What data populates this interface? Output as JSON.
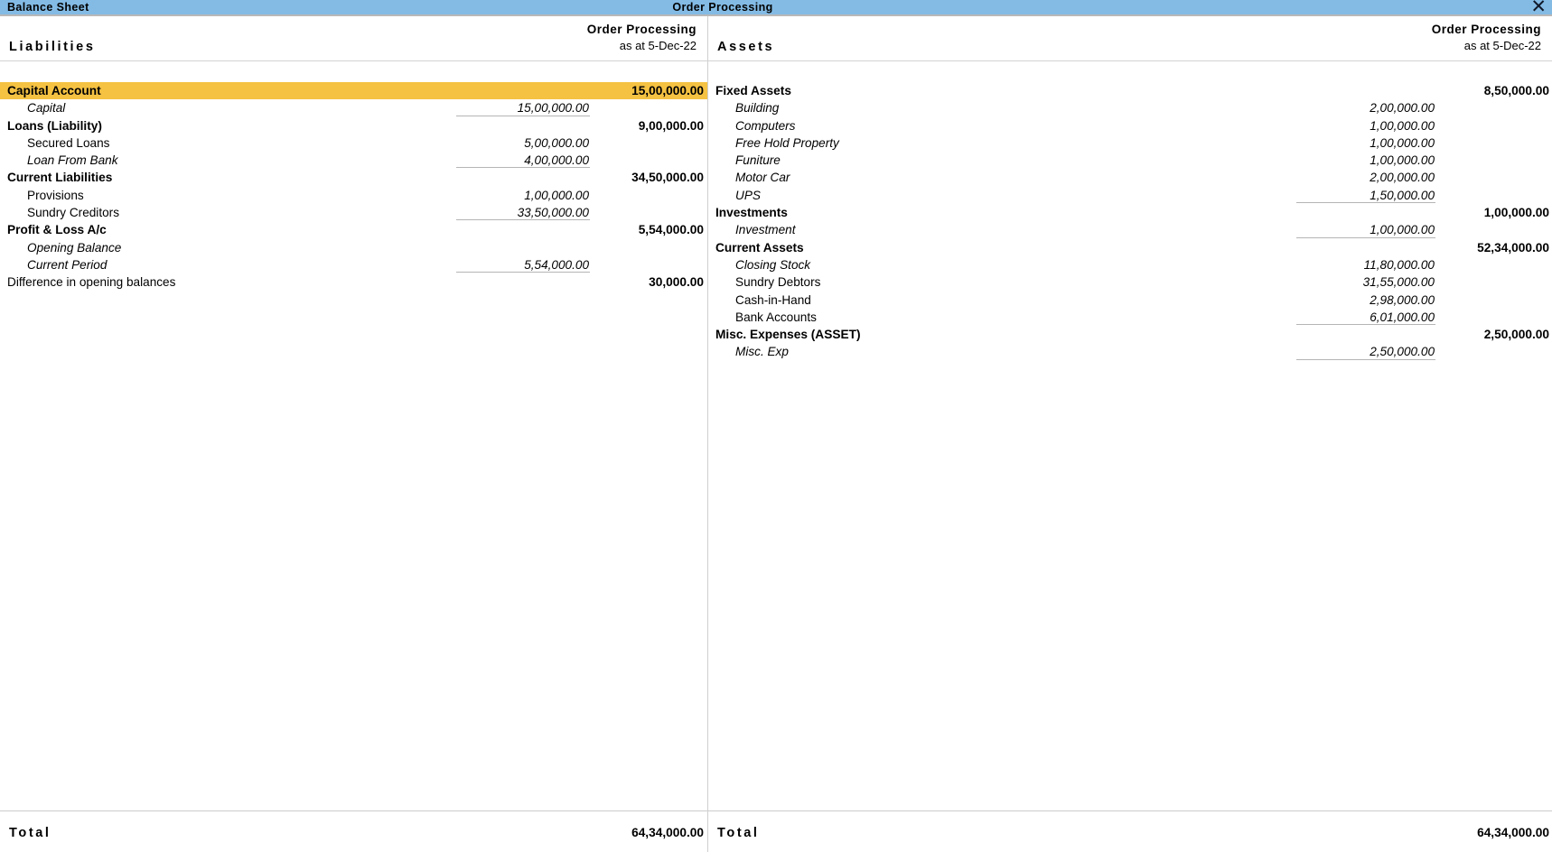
{
  "titlebar": {
    "report_title": "Balance Sheet",
    "company_title": "Order  Processing",
    "close_label": "✕"
  },
  "left": {
    "side_title": "Liabilities",
    "company": "Order  Processing",
    "as_at": "as at 5-Dec-22",
    "total_label": "Total",
    "total_amount": "64,34,000.00",
    "rows": [
      {
        "label": "Capital Account",
        "kind": "group",
        "italic": false,
        "highlight": true,
        "total": "15,00,000.00"
      },
      {
        "label": "Capital",
        "kind": "item",
        "italic": true,
        "ruled": true,
        "sub": "15,00,000.00"
      },
      {
        "label": "Loans (Liability)",
        "kind": "group",
        "italic": false,
        "total": "9,00,000.00"
      },
      {
        "label": "Secured Loans",
        "kind": "item",
        "italic": false,
        "sub": "5,00,000.00"
      },
      {
        "label": "Loan From Bank",
        "kind": "item",
        "italic": true,
        "ruled": true,
        "sub": "4,00,000.00"
      },
      {
        "label": "Current Liabilities",
        "kind": "group",
        "italic": false,
        "total": "34,50,000.00"
      },
      {
        "label": "Provisions",
        "kind": "item",
        "italic": false,
        "sub": "1,00,000.00"
      },
      {
        "label": "Sundry Creditors",
        "kind": "item",
        "italic": false,
        "ruled": true,
        "sub": "33,50,000.00"
      },
      {
        "label": "Profit & Loss A/c",
        "kind": "group",
        "italic": false,
        "total": "5,54,000.00"
      },
      {
        "label": "Opening Balance",
        "kind": "item",
        "italic": true,
        "sub": ""
      },
      {
        "label": "Current Period",
        "kind": "item",
        "italic": true,
        "ruled": true,
        "sub": "5,54,000.00"
      },
      {
        "label": "Difference in opening balances",
        "kind": "plain",
        "italic": false,
        "total": "30,000.00"
      }
    ]
  },
  "right": {
    "side_title": "Assets",
    "company": "Order  Processing",
    "as_at": "as at 5-Dec-22",
    "total_label": "Total",
    "total_amount": "64,34,000.00",
    "rows": [
      {
        "label": "Fixed Assets",
        "kind": "group",
        "italic": false,
        "total": "8,50,000.00"
      },
      {
        "label": "Building",
        "kind": "item",
        "italic": true,
        "sub": "2,00,000.00"
      },
      {
        "label": "Computers",
        "kind": "item",
        "italic": true,
        "sub": "1,00,000.00"
      },
      {
        "label": "Free Hold Property",
        "kind": "item",
        "italic": true,
        "sub": "1,00,000.00"
      },
      {
        "label": "Funiture",
        "kind": "item",
        "italic": true,
        "sub": "1,00,000.00"
      },
      {
        "label": "Motor Car",
        "kind": "item",
        "italic": true,
        "sub": "2,00,000.00"
      },
      {
        "label": "UPS",
        "kind": "item",
        "italic": true,
        "ruled": true,
        "sub": "1,50,000.00"
      },
      {
        "label": "Investments",
        "kind": "group",
        "italic": false,
        "total": "1,00,000.00"
      },
      {
        "label": "Investment",
        "kind": "item",
        "italic": true,
        "ruled": true,
        "sub": "1,00,000.00"
      },
      {
        "label": "Current Assets",
        "kind": "group",
        "italic": false,
        "total": "52,34,000.00"
      },
      {
        "label": "Closing Stock",
        "kind": "item",
        "italic": true,
        "sub": "11,80,000.00"
      },
      {
        "label": "Sundry Debtors",
        "kind": "item",
        "italic": false,
        "sub": "31,55,000.00"
      },
      {
        "label": "Cash-in-Hand",
        "kind": "item",
        "italic": false,
        "sub": "2,98,000.00"
      },
      {
        "label": "Bank Accounts",
        "kind": "item",
        "italic": false,
        "ruled": true,
        "sub": "6,01,000.00"
      },
      {
        "label": "Misc. Expenses (ASSET)",
        "kind": "group",
        "italic": false,
        "total": "2,50,000.00"
      },
      {
        "label": "Misc. Exp",
        "kind": "item",
        "italic": true,
        "ruled": true,
        "sub": "2,50,000.00"
      }
    ]
  },
  "colors": {
    "titlebar": "#83bbe5",
    "highlight": "#f5c242"
  }
}
